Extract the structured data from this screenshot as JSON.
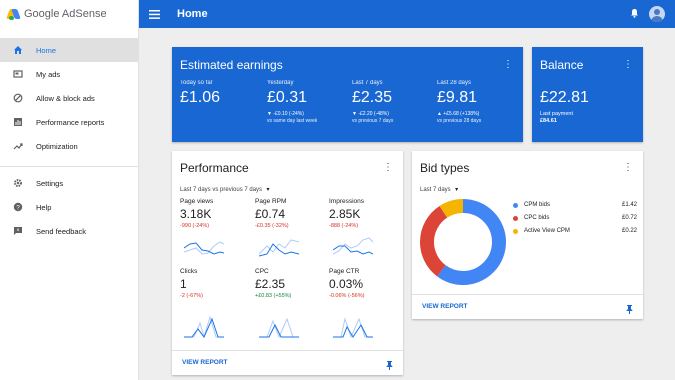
{
  "brand": {
    "name": "Google AdSense"
  },
  "sidebar": {
    "items": [
      {
        "label": "Home"
      },
      {
        "label": "My ads"
      },
      {
        "label": "Allow & block ads"
      },
      {
        "label": "Performance reports"
      },
      {
        "label": "Optimization"
      },
      {
        "label": "Settings"
      },
      {
        "label": "Help"
      },
      {
        "label": "Send feedback"
      }
    ]
  },
  "topbar": {
    "title": "Home"
  },
  "earnings": {
    "title": "Estimated earnings",
    "cols": [
      {
        "label": "Today so far",
        "value": "£1.06",
        "delta": "",
        "compare": ""
      },
      {
        "label": "Yesterday",
        "value": "£0.31",
        "delta": "▼ -£0.10 (-24%)",
        "compare": "vs same day last week"
      },
      {
        "label": "Last 7 days",
        "value": "£2.35",
        "delta": "▼ -£2.20 (-48%)",
        "compare": "vs previous 7 days"
      },
      {
        "label": "Last 28 days",
        "value": "£9.81",
        "delta": "▲ +£5.68 (+138%)",
        "compare": "vs previous 28 days"
      }
    ]
  },
  "balance": {
    "title": "Balance",
    "value": "£22.81",
    "last_payment_label": "Last payment",
    "last_payment_value": "£84.61"
  },
  "performance": {
    "title": "Performance",
    "range": "Last 7 days vs previous 7 days",
    "metrics": [
      {
        "label": "Page views",
        "value": "3.18K",
        "change": "-990 (-24%)",
        "trend": "neg"
      },
      {
        "label": "Page RPM",
        "value": "£0.74",
        "change": "-£0.35 (-32%)",
        "trend": "neg"
      },
      {
        "label": "Impressions",
        "value": "2.85K",
        "change": "-888 (-24%)",
        "trend": "neg"
      },
      {
        "label": "Clicks",
        "value": "1",
        "change": "-2 (-67%)",
        "trend": "neg"
      },
      {
        "label": "CPC",
        "value": "£2.35",
        "change": "+£0.83 (+55%)",
        "trend": "pos"
      },
      {
        "label": "Page CTR",
        "value": "0.03%",
        "change": "-0.06% (-56%)",
        "trend": "neg"
      }
    ],
    "view_report": "VIEW REPORT"
  },
  "bid_types": {
    "title": "Bid types",
    "range": "Last 7 days",
    "items": [
      {
        "label": "CPM bids",
        "value": "£1.42",
        "amount": 1.42,
        "color": "#4285f4"
      },
      {
        "label": "CPC bids",
        "value": "£0.72",
        "amount": 0.72,
        "color": "#db4437"
      },
      {
        "label": "Active View CPM",
        "value": "£0.22",
        "amount": 0.22,
        "color": "#f4b400"
      }
    ],
    "view_report": "VIEW REPORT"
  },
  "colors": {
    "primary": "#1967d2",
    "negative": "#d93025",
    "positive": "#188038"
  }
}
